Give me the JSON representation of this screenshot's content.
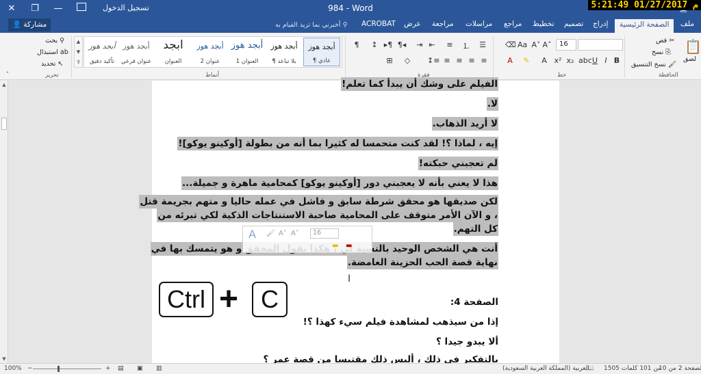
{
  "window": {
    "title": "984  -  Word",
    "signin": "تسجيل الدخول",
    "clock": "5:21:49 01/27/2017 م"
  },
  "tabs": {
    "items": [
      "ملف",
      "الصفحة الرئيسية",
      "إدراج",
      "تصميم",
      "تخطيط",
      "مراجع",
      "مراسلات",
      "مراجعة",
      "عرض",
      "ACROBAT"
    ],
    "tellme": "أخبرني بما تريد القيام به",
    "share": "مشاركة"
  },
  "ribbon": {
    "clipboard": {
      "label": "الحافظة",
      "paste": "لصق",
      "cut": "قص",
      "copy": "نسخ",
      "format_painter": "نسخ التنسيق"
    },
    "font": {
      "label": "خط",
      "size": "16",
      "bold": "B",
      "italic": "I",
      "underline": "U"
    },
    "paragraph": {
      "label": "فقرة"
    },
    "styles": {
      "label": "أنماط",
      "items": [
        {
          "sample": "أبجد هوز",
          "name": "¶ عادي"
        },
        {
          "sample": "أبجد هوز",
          "name": "¶ بلا تباعد"
        },
        {
          "sample": "أبجد هوز",
          "name": "العنوان 1"
        },
        {
          "sample": "أبجد هوز",
          "name": "عنوان 2"
        },
        {
          "sample": "ابجد",
          "name": "العنوان"
        },
        {
          "sample": "أبجد هوز",
          "name": "عنوان فرعي"
        },
        {
          "sample": "أبجد هوز",
          "name": "تأكيد دقيق"
        }
      ]
    },
    "editing": {
      "label": "تحرير",
      "find": "بحث",
      "replace": "استبدال",
      "select": "تحديد"
    }
  },
  "document": {
    "lines": [
      "الفيلم على وشك أن يبدأ كما تعلم!",
      "لا.",
      "لا أريد الذهاب.",
      "إيه ، لماذا ؟! لقد كنت متحمسا له كثيرا بما أنه من بطولة [أوكينو يوكو]!",
      "لم تعجبني حبكته!",
      "هذا لا يعني بأنه لا يعجبني دور [أوكينو يوكو] كمحامية ماهرة و جميلة...",
      "لكن صديقها هو محقق شرطة سابق و فاشل في عمله حاليا و متهم بجريمة قتل",
      "، و الآن الأمر متوقف على المحامية صاحبة الاستنتاجات الذكية لكي تبرئه من",
      "كل التهم.",
      "أنت هي الشخص الوحيد بالنسبة لي ، هكذا يقول المحقق و هو يتمسك بها في",
      "نهاية قصة الحب الحزينة الغامضة.",
      "الصفحة 4:",
      "إذا من سيذهب لمشاهدة فيلم سيء كهذا ؟!",
      "ألا يبدو جيدا ؟",
      "بالتفكير في ذلك ، أليس ذلك مقتبسا من قصة عمرٍ ؟"
    ],
    "mini_toolbar": {
      "size": "16"
    },
    "keys": {
      "ctrl": "Ctrl",
      "plus": "+",
      "c": "C"
    }
  },
  "statusbar": {
    "page": "الصفحة 2 من 10",
    "words": "1505 من 101 كلمات",
    "language": "العربية (المملكة العربية السعودية)",
    "zoom": "100%"
  }
}
